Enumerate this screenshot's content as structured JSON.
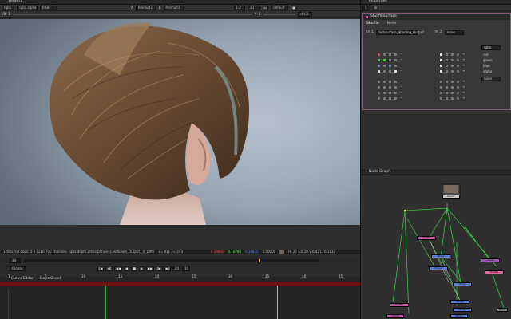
{
  "viewer": {
    "tab_label": "Viewer1",
    "toolbar1": {
      "layer": "rgba",
      "channel": "rgba.alpha",
      "colorspace": "RGB",
      "input_a": "A",
      "input_a_node": "Premult2",
      "input_b": "B",
      "input_b_node": "Premult3",
      "zoom": "1:2",
      "view_mode": "3D",
      "lut": "default",
      "display": "sRGB"
    },
    "toolbar2": {
      "fstop": "f/8",
      "frame": "1",
      "y_label": "Y",
      "y_value": "1"
    },
    "info_bar": {
      "format": "1280x700 bbox: 0 0 1280 700 channels: rgba,depth,other/Diffuse_Coefficient_Output__0_DiffU",
      "xy": "x= 811 y= 243",
      "r": "0.10840",
      "g": "0.10780",
      "b": "0.10835",
      "a": "0.00000",
      "hsvl": "H: 27 S:0.38 V:0.42 L: 0.1132"
    },
    "timeline": {
      "current_frame": "34",
      "global_label": "Global",
      "fps": "24",
      "step": "10",
      "ticks": [
        "1",
        "5",
        "10",
        "15",
        "20",
        "25",
        "30",
        "35",
        "40",
        "45"
      ]
    },
    "curve_tabs": [
      "Curve Editor",
      "Dope Sheet"
    ]
  },
  "properties": {
    "tab_label": "Properties",
    "counter": "5",
    "node_title": "ShuffleSurface",
    "tabs": [
      "Shuffle",
      "Node"
    ],
    "in1_label": "in 1",
    "in1_value": "Subsurface_Shading_Output",
    "in2_label": "in 2",
    "in2_value": "none",
    "out_layer": "rgba",
    "out_channels": [
      "red",
      "green",
      "blue",
      "alpha"
    ],
    "out2_value": "none"
  },
  "node_graph": {
    "tab_label": "Node Graph",
    "nodes": [
      {
        "label": "Read1",
        "color": "#c9c9c9"
      },
      {
        "label": "Shuffle",
        "color": "#c25aa7"
      },
      {
        "label": "Shuffle",
        "color": "#c25aa7"
      },
      {
        "label": "Merge",
        "color": "#5b7fd6"
      },
      {
        "label": "Merge",
        "color": "#5b7fd6"
      },
      {
        "label": "Grade",
        "color": "#9b59b6"
      },
      {
        "label": "Merge",
        "color": "#5b7fd6"
      },
      {
        "label": "Merge",
        "color": "#5b7fd6"
      },
      {
        "label": "Grade",
        "color": "#c25aa7"
      },
      {
        "label": "Merge",
        "color": "#5b7fd6"
      },
      {
        "label": "Shuffle",
        "color": "#d96aa0"
      },
      {
        "label": "Merge",
        "color": "#5b7fd6"
      },
      {
        "label": "Read",
        "color": "#888888"
      }
    ]
  },
  "colors": {
    "accent_green": "#3bd24b",
    "accent_red": "#e04040",
    "playhead": "#f2a23a",
    "panel_border": "#8a5a7a"
  }
}
